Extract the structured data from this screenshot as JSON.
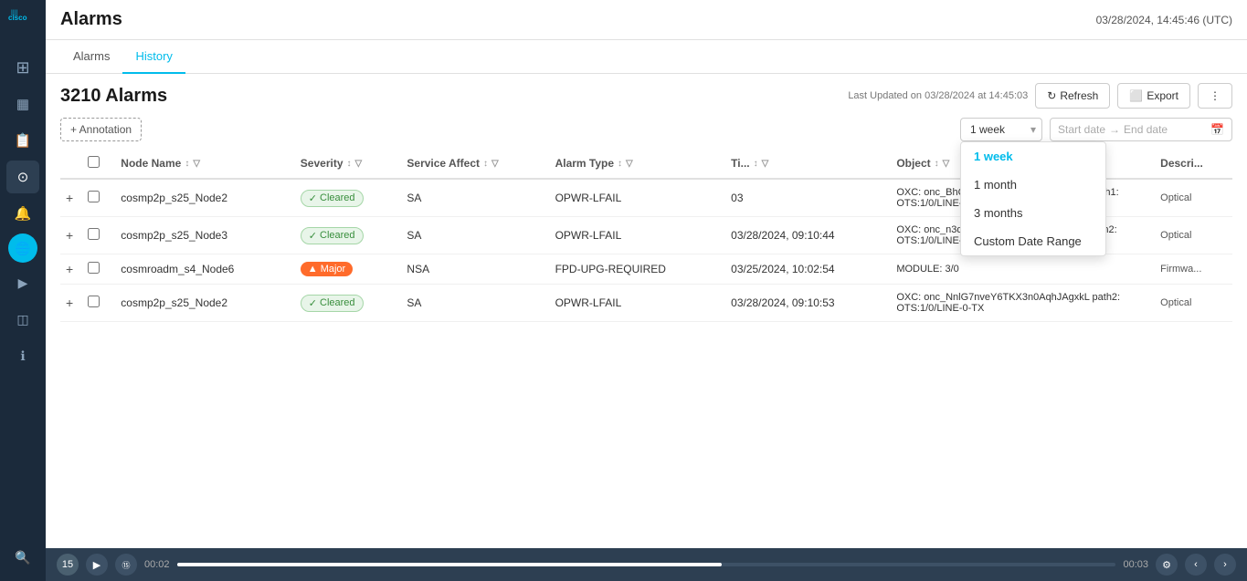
{
  "app": {
    "title": "Alarms",
    "timestamp": "03/28/2024, 14:45:46 (UTC)"
  },
  "tabs": [
    {
      "id": "alarms",
      "label": "Alarms",
      "active": false
    },
    {
      "id": "history",
      "label": "History",
      "active": true
    }
  ],
  "toolbar": {
    "alarm_count": "3210 Alarms",
    "last_updated": "Last Updated on 03/28/2024 at 14:45:03",
    "refresh_label": "Refresh",
    "export_label": "Export"
  },
  "filter": {
    "annotation_label": "+ Annotation",
    "time_value": "1 week",
    "date_start_placeholder": "Start date",
    "date_end_placeholder": "End date",
    "dropdown_options": [
      {
        "id": "1week",
        "label": "1 week",
        "selected": true
      },
      {
        "id": "1month",
        "label": "1 month",
        "selected": false
      },
      {
        "id": "3months",
        "label": "3 months",
        "selected": false
      },
      {
        "id": "custom",
        "label": "Custom Date Range",
        "selected": false
      }
    ]
  },
  "table": {
    "columns": [
      {
        "id": "checkbox",
        "label": ""
      },
      {
        "id": "node_name",
        "label": "Node Name"
      },
      {
        "id": "severity",
        "label": "Severity"
      },
      {
        "id": "service_affect",
        "label": "Service Affect"
      },
      {
        "id": "alarm_type",
        "label": "Alarm Type"
      },
      {
        "id": "time",
        "label": "Ti..."
      },
      {
        "id": "object",
        "label": "Object"
      },
      {
        "id": "descri",
        "label": "Descri..."
      }
    ],
    "rows": [
      {
        "id": 1,
        "node_name": "cosmp2p_s25_Node2",
        "severity": "Cleared",
        "severity_type": "cleared",
        "service_affect": "SA",
        "alarm_type": "OPWR-LFAIL",
        "time": "03",
        "object": "OXC: onc_BhQLCM9RQznuiv4opI5l7X1F9 path1: OTS:1/0/LINE-2-TX",
        "description": "Optical"
      },
      {
        "id": 2,
        "node_name": "cosmp2p_s25_Node3",
        "severity": "Cleared",
        "severity_type": "cleared",
        "service_affect": "SA",
        "alarm_type": "OPWR-LFAIL",
        "time": "03/28/2024, 09:10:44",
        "object": "OXC: onc_n3dJatSckNrBtKtUqVhPxHVEY path2: OTS:1/0/LINE-TX",
        "description": "Optical"
      },
      {
        "id": 3,
        "node_name": "cosmroadm_s4_Node6",
        "severity": "Major",
        "severity_type": "major",
        "service_affect": "NSA",
        "alarm_type": "FPD-UPG-REQUIRED",
        "time": "03/25/2024, 10:02:54",
        "object": "MODULE: 3/0",
        "description": "Firmwa..."
      },
      {
        "id": 4,
        "node_name": "cosmp2p_s25_Node2",
        "severity": "Cleared",
        "severity_type": "cleared",
        "service_affect": "SA",
        "alarm_type": "OPWR-LFAIL",
        "time": "03/28/2024, 09:10:53",
        "object": "OXC: onc_NnlG7nveY6TKX3n0AqhJAgxkL path2: OTS:1/0/LINE-0-TX",
        "description": "Optical"
      }
    ]
  },
  "bottom_bar": {
    "time_start": "00:02",
    "time_end": "00:03",
    "badge_number": "15",
    "progress_percent": 58
  },
  "sidebar": {
    "items": [
      {
        "id": "home",
        "icon": "⊞",
        "active": false
      },
      {
        "id": "dashboard",
        "icon": "▦",
        "active": false
      },
      {
        "id": "docs",
        "icon": "📄",
        "active": false
      },
      {
        "id": "network",
        "icon": "⊙",
        "active": false
      },
      {
        "id": "alarms",
        "icon": "🔔",
        "active": true
      },
      {
        "id": "globe",
        "icon": "🌐",
        "active": false
      },
      {
        "id": "play",
        "icon": "▶",
        "active": false
      },
      {
        "id": "layers",
        "icon": "◫",
        "active": false
      },
      {
        "id": "info",
        "icon": "ℹ",
        "active": false
      },
      {
        "id": "search",
        "icon": "🔍",
        "active": false
      }
    ]
  }
}
